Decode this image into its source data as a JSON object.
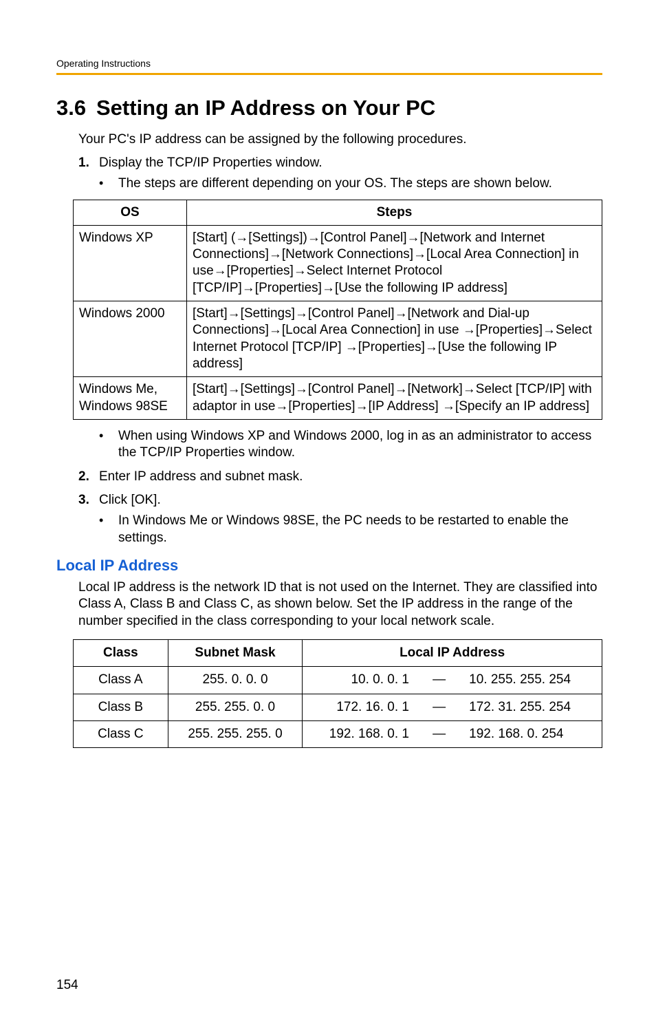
{
  "running_head": "Operating Instructions",
  "section_number": "3.6",
  "section_title": "Setting an IP Address on Your PC",
  "intro": "Your PC's IP address can be assigned by the following procedures.",
  "step1_num": "1.",
  "step1_text": "Display the TCP/IP Properties window.",
  "step1_bullet": "The steps are different depending on your OS. The steps are shown below.",
  "os_table": {
    "head_os": "OS",
    "head_steps": "Steps",
    "rows": [
      {
        "os": "Windows XP",
        "steps": "[Start] (→[Settings])→[Control Panel]→[Network and Internet Connections]→[Network Connections]→[Local Area Connection] in use→[Properties]→Select Internet Protocol [TCP/IP]→[Properties]→[Use the following IP address]"
      },
      {
        "os": "Windows 2000",
        "steps": "[Start]→[Settings]→[Control Panel]→[Network and Dial-up Connections]→[Local Area Connection] in use →[Properties]→Select Internet Protocol [TCP/IP] →[Properties]→[Use the following IP address]"
      },
      {
        "os": "Windows Me, Windows 98SE",
        "steps": "[Start]→[Settings]→[Control Panel]→[Network]→Select [TCP/IP] with adaptor in use→[Properties]→[IP Address] →[Specify an IP address]"
      }
    ]
  },
  "post_table_bullet": "When using Windows XP and Windows 2000, log in as an administrator to access the TCP/IP Properties window.",
  "step2_num": "2.",
  "step2_text": "Enter IP address and subnet mask.",
  "step3_num": "3.",
  "step3_text": "Click [OK].",
  "step3_bullet": "In Windows Me or Windows 98SE, the PC needs to be restarted to enable the settings.",
  "local_heading": "Local IP Address",
  "local_intro": "Local IP address is the network ID that is not used on the Internet. They are classified into Class A, Class B and Class C, as shown below. Set the IP address in the range of the number specified in the class corresponding to your local network scale.",
  "ip_table": {
    "head_class": "Class",
    "head_mask": "Subnet Mask",
    "head_addr": "Local IP Address",
    "rows": [
      {
        "class": "Class A",
        "mask": "255. 0. 0. 0",
        "from": "10. 0. 0. 1",
        "dash": "—",
        "to": "10. 255. 255. 254"
      },
      {
        "class": "Class B",
        "mask": "255. 255. 0. 0",
        "from": "172. 16. 0. 1",
        "dash": "—",
        "to": "172. 31. 255. 254"
      },
      {
        "class": "Class C",
        "mask": "255. 255. 255. 0",
        "from": "192. 168. 0. 1",
        "dash": "—",
        "to": "192. 168. 0. 254"
      }
    ]
  },
  "page_number": "154"
}
